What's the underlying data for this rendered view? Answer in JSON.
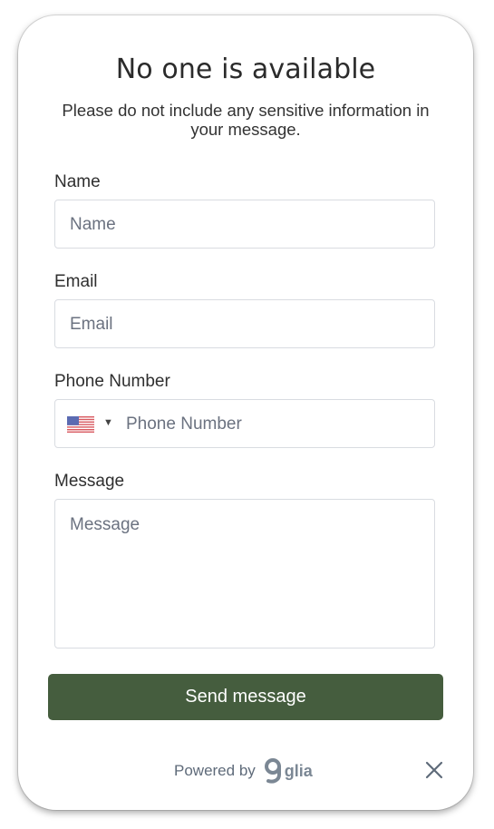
{
  "dialog": {
    "title": "No one is available",
    "subtitle": "Please do not include any sensitive information in your message."
  },
  "form": {
    "name_label": "Name",
    "name_placeholder": "Name",
    "email_label": "Email",
    "email_placeholder": "Email",
    "phone_label": "Phone Number",
    "phone_placeholder": "Phone Number",
    "country_flag_icon": "us-flag-icon",
    "message_label": "Message",
    "message_placeholder": "Message"
  },
  "actions": {
    "send_label": "Send message"
  },
  "footer": {
    "powered_by": "Powered by",
    "brand": "glia",
    "close_icon": "close-icon"
  },
  "colors": {
    "primary_button": "#455d3e",
    "input_border": "#d9dce1",
    "placeholder": "#6b7280"
  }
}
